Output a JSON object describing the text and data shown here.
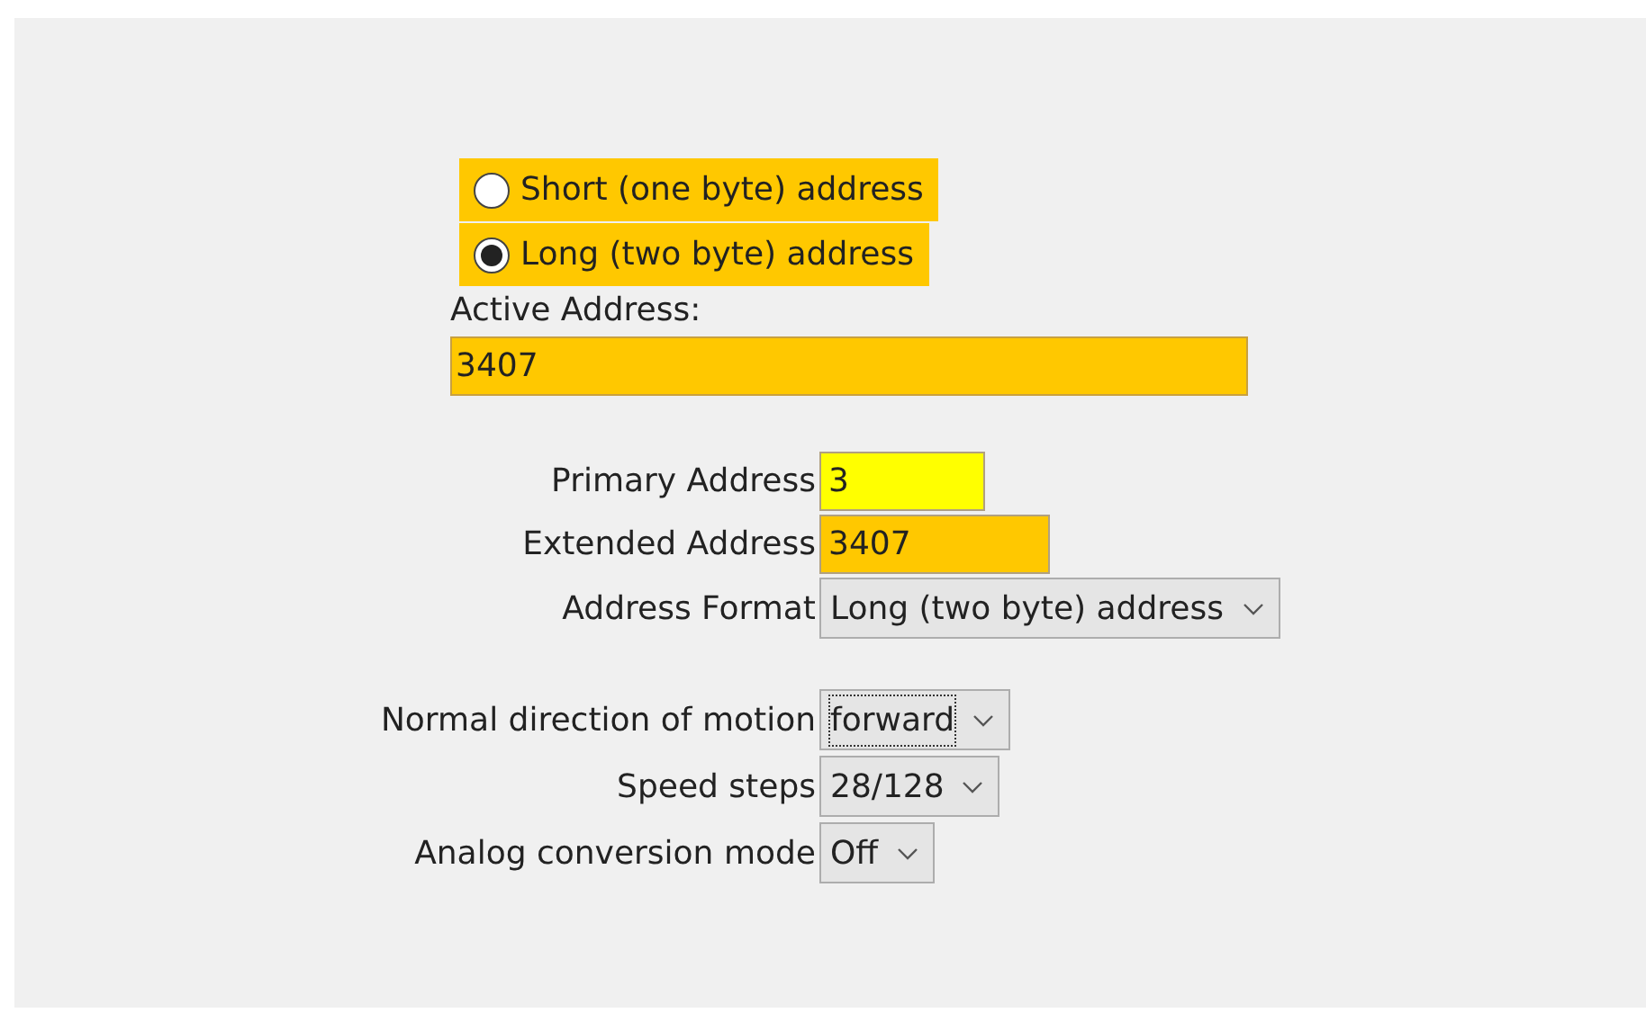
{
  "address_mode": [
    {
      "label": "Short (one byte) address",
      "selected": false
    },
    {
      "label": "Long (two byte) address",
      "selected": true
    }
  ],
  "active_address": {
    "label": "Active Address:",
    "value": "3407"
  },
  "address_fields": [
    {
      "label": "Primary Address",
      "value": "3",
      "color": "#ffff00",
      "kind": "field"
    },
    {
      "label": "Extended Address",
      "value": "3407",
      "color": "#ffc800",
      "kind": "field"
    },
    {
      "label": "Address Format",
      "value": "Long (two byte) address",
      "kind": "dropdown",
      "focused": false
    }
  ],
  "settings": [
    {
      "label": "Normal direction of motion",
      "value": "forward",
      "kind": "dropdown",
      "focused": true
    },
    {
      "label": "Speed steps",
      "value": "28/128",
      "kind": "dropdown",
      "focused": false
    },
    {
      "label": "Analog conversion mode",
      "value": "Off",
      "kind": "dropdown",
      "focused": false
    }
  ]
}
